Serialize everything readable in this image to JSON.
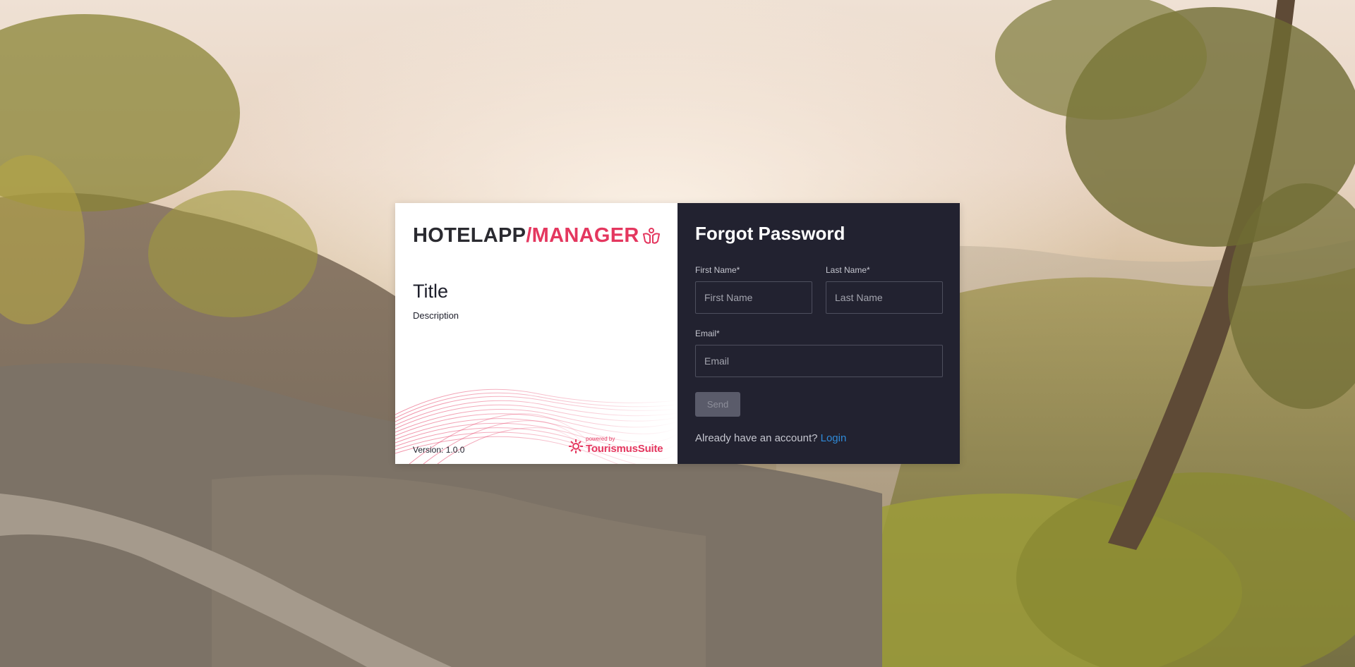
{
  "brand": {
    "name_part1": "HOTELAPP",
    "name_part2": "/MANAGER",
    "icon": "hands-icon",
    "accent_color": "#e4375f"
  },
  "info": {
    "title": "Title",
    "description": "Description",
    "version": "Version: 1.0.0"
  },
  "powered": {
    "by": "powered by",
    "name": "TourismusSuite",
    "icon": "gear-icon"
  },
  "form": {
    "title": "Forgot Password",
    "first_name": {
      "label": "First Name*",
      "placeholder": "First Name",
      "value": ""
    },
    "last_name": {
      "label": "Last Name*",
      "placeholder": "Last Name",
      "value": ""
    },
    "email": {
      "label": "Email*",
      "placeholder": "Email",
      "value": ""
    },
    "send_label": "Send",
    "account_text": "Already have an account?",
    "login_label": "Login",
    "panel_color": "#222230",
    "link_color": "#2f8ad8"
  }
}
